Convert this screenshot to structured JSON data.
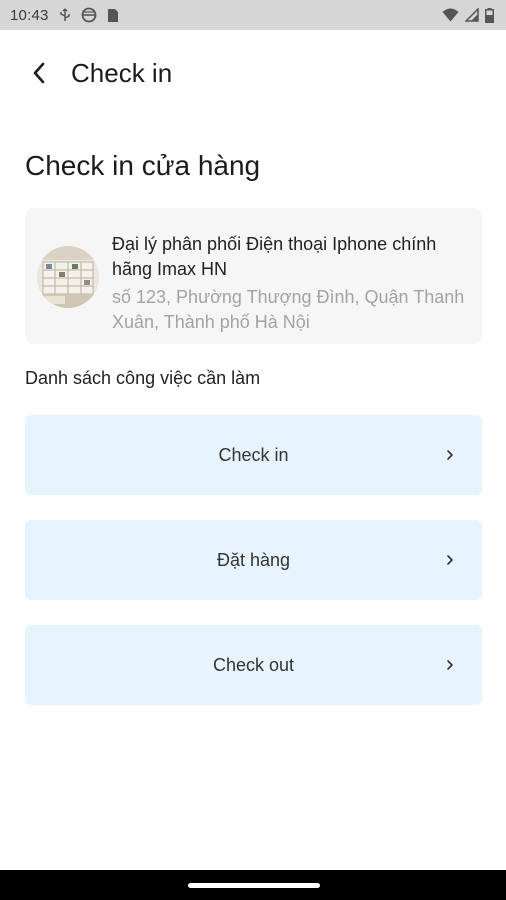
{
  "status_bar": {
    "time": "10:43",
    "left_icons": [
      "usb-icon",
      "vpn-globe-icon",
      "sim-card-icon"
    ],
    "right_icons": [
      "wifi-icon",
      "signal-icon",
      "battery-icon"
    ]
  },
  "header": {
    "back_icon": "chevron-left-icon",
    "title": "Check in"
  },
  "page": {
    "section_title": "Check in cửa hàng",
    "store": {
      "name": "Đại lý phân phối Điện thoại Iphone chính hãng Imax HN",
      "address": "số 123, Phường Thượng Đình, Quận Thanh Xuân, Thành phố Hà Nội"
    },
    "task_list_heading": "Danh sách công việc cần làm",
    "tasks": [
      {
        "label": "Check in"
      },
      {
        "label": "Đặt hàng"
      },
      {
        "label": "Check out"
      }
    ]
  },
  "colors": {
    "task_bg": "#e7f3fd",
    "card_bg": "#f6f6f6",
    "address_text": "#a3a3a3"
  }
}
